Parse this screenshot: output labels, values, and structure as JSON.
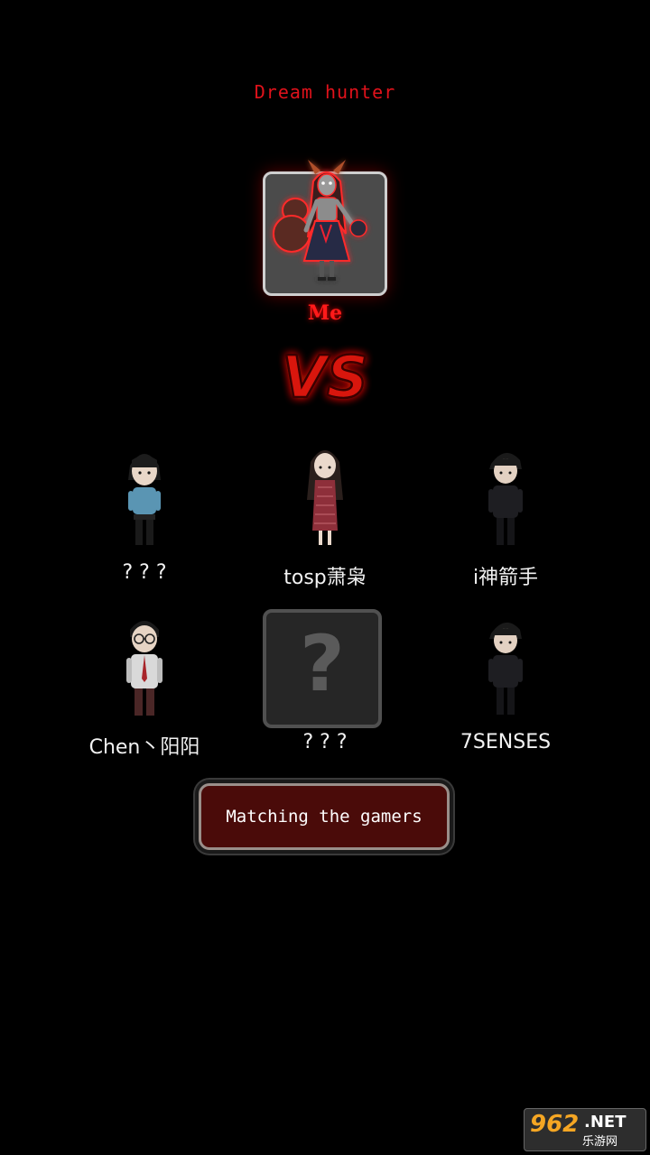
{
  "header": {
    "title": "Dream hunter"
  },
  "hunter": {
    "label": "Me"
  },
  "versus": {
    "text": "VS"
  },
  "players": [
    {
      "name": "? ? ?",
      "avatar": "schoolgirl-character"
    },
    {
      "name": "tosp萧枭",
      "avatar": "qipao-woman-character"
    },
    {
      "name": "i神箭手",
      "avatar": "dark-uniform-boy-character"
    },
    {
      "name": "Chen丶阳阳",
      "avatar": "glasses-man-character"
    },
    {
      "name": "? ? ?",
      "avatar": "unknown-slot"
    },
    {
      "name": "7SENSES",
      "avatar": "dark-uniform-boy-character"
    }
  ],
  "unknown_slot": {
    "symbol": "?"
  },
  "status_button": {
    "label": "Matching the gamers"
  },
  "watermark": {
    "number": "962",
    "suffix": ".NET",
    "subtitle": "乐游网"
  },
  "colors": {
    "title_red": "#e0121b",
    "button_bg": "#4a0b09",
    "background": "#000000"
  }
}
